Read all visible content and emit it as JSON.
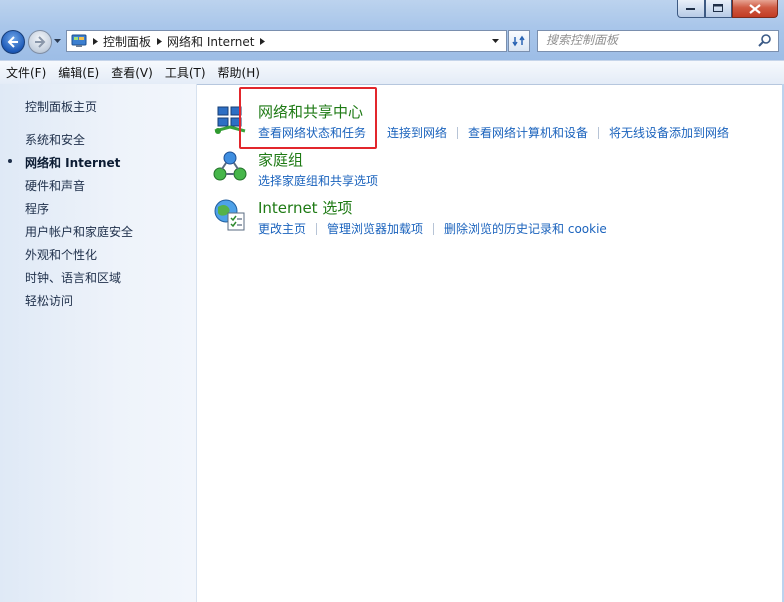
{
  "nav": {
    "breadcrumbs": [
      "控制面板",
      "网络和 Internet"
    ],
    "search_placeholder": "搜索控制面板"
  },
  "menu": [
    "文件(F)",
    "编辑(E)",
    "查看(V)",
    "工具(T)",
    "帮助(H)"
  ],
  "sidebar": {
    "items": [
      {
        "label": "控制面板主页",
        "active": false
      },
      {
        "label": "系统和安全",
        "active": false
      },
      {
        "label": "网络和 Internet",
        "active": true
      },
      {
        "label": "硬件和声音",
        "active": false
      },
      {
        "label": "程序",
        "active": false
      },
      {
        "label": "用户帐户和家庭安全",
        "active": false
      },
      {
        "label": "外观和个性化",
        "active": false
      },
      {
        "label": "时钟、语言和区域",
        "active": false
      },
      {
        "label": "轻松访问",
        "active": false
      }
    ]
  },
  "main": {
    "categories": [
      {
        "title": "网络和共享中心",
        "icon": "network-sharing-icon",
        "links": [
          "查看网络状态和任务",
          "连接到网络",
          "查看网络计算机和设备",
          "将无线设备添加到网络"
        ]
      },
      {
        "title": "家庭组",
        "icon": "homegroup-icon",
        "links": [
          "选择家庭组和共享选项"
        ]
      },
      {
        "title": "Internet 选项",
        "icon": "internet-options-icon",
        "links": [
          "更改主页",
          "管理浏览器加载项",
          "删除浏览的历史记录和 cookie"
        ]
      }
    ]
  },
  "colors": {
    "category_title": "#1e7a14",
    "link": "#1b63bd",
    "highlight_box": "#e2262c",
    "chrome": "#a9c6ea"
  }
}
